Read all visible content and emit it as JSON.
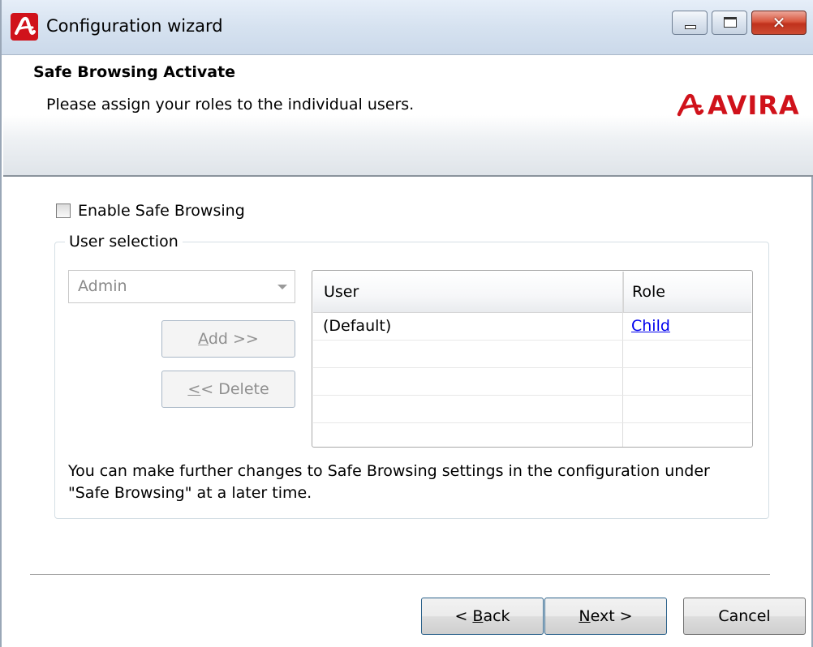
{
  "window": {
    "title": "Configuration wizard",
    "controls": {
      "minimize": "minimize",
      "maximize": "maximize",
      "close": "✕"
    }
  },
  "header": {
    "heading": "Safe Browsing Activate",
    "subtitle": "Please assign your roles to the individual users.",
    "brand": "AVIRA",
    "brand_color": "#d0121b"
  },
  "enable_checkbox": {
    "label": "Enable Safe Browsing",
    "checked": false
  },
  "user_selection": {
    "legend": "User selection",
    "dropdown_value": "Admin",
    "add_button": {
      "mnemonic": "A",
      "rest": "dd >>"
    },
    "delete_button": {
      "mnemonic": "<",
      "rest": "< Delete"
    },
    "table": {
      "columns": [
        "User",
        "Role"
      ],
      "rows": [
        {
          "user": "(Default)",
          "role": "Child"
        }
      ]
    },
    "info": "You can make further changes to Safe Browsing settings in the configuration under \"Safe Browsing\" at a later time."
  },
  "footer": {
    "back": {
      "prefix": "< ",
      "mnemonic": "B",
      "rest": "ack"
    },
    "next": {
      "mnemonic": "N",
      "rest": "ext >"
    },
    "cancel": "Cancel"
  }
}
